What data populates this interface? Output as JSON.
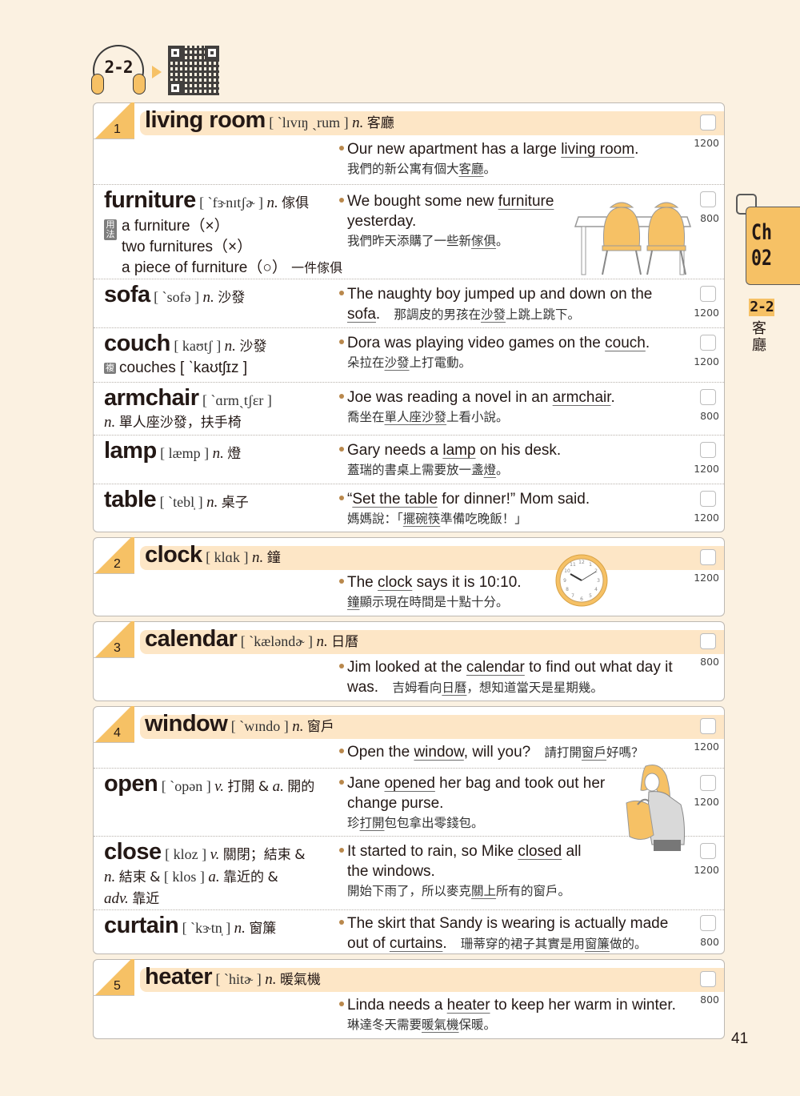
{
  "header": {
    "audio_track": "2-2",
    "audio_icon": "headphones-icon",
    "qr_icon": "qr-code-icon"
  },
  "side_tab": {
    "chapter_line1": "Ch",
    "chapter_line2": "02",
    "section": "2-2",
    "section_title_1": "客",
    "section_title_2": "廳"
  },
  "page_number": "41",
  "cards": [
    {
      "number": "1",
      "entries": [
        {
          "word": "living room",
          "ipa": "[ ˋlɪvɪŋ ˏrum ]",
          "pos": "n.",
          "zh": "客廳",
          "example_pre": "Our new apartment has a large ",
          "example_ul": "living room",
          "example_post": ".",
          "zh_pre": "我們的新公寓有個大",
          "zh_ul": "客廳",
          "zh_post": "。",
          "level": "1200",
          "checked": false
        },
        {
          "word": "furniture",
          "ipa": "[ ˋfɝnɪtʃɚ ]",
          "pos": "n.",
          "zh": "傢俱",
          "usage_tag": "用法",
          "usage_lines": [
            "a furniture（×）",
            "two furnitures（×）",
            "a piece of furniture（○）"
          ],
          "usage_zh": "一件傢俱",
          "example_pre": "We bought some new ",
          "example_ul": "furniture",
          "example_post": " yesterday.",
          "zh_pre": "我們昨天添購了一些新",
          "zh_ul": "傢俱",
          "zh_post": "。",
          "level": "800",
          "checked": false
        },
        {
          "word": "sofa",
          "ipa": "[ ˋsofə ]",
          "pos": "n.",
          "zh": "沙發",
          "example_pre": "The naughty boy jumped up and down on the ",
          "example_ul": "sofa",
          "example_post": ".",
          "zh_pre": "那調皮的男孩在",
          "zh_ul": "沙發",
          "zh_post": "上跳上跳下。",
          "level": "1200",
          "checked": false
        },
        {
          "word": "couch",
          "ipa": "[ kaʊtʃ ]",
          "pos": "n.",
          "zh": "沙發",
          "plural_tag": "複",
          "plural": "couches [ ˋkaʊtʃɪz ]",
          "example_pre": "Dora was playing video games on the ",
          "example_ul": "couch",
          "example_post": ".",
          "zh_pre": "朵拉在",
          "zh_ul": "沙發",
          "zh_post": "上打電動。",
          "level": "1200",
          "checked": false
        },
        {
          "word": "armchair",
          "ipa": "[ ˋɑrmˏtʃɛr ]",
          "pos": "n.",
          "zh": "單人座沙發，扶手椅",
          "example_pre": "Joe was reading a novel in an ",
          "example_ul": "armchair",
          "example_post": ".",
          "zh_pre": "喬坐在",
          "zh_ul": "單人座沙發",
          "zh_post": "上看小說。",
          "level": "800",
          "checked": false
        },
        {
          "word": "lamp",
          "ipa": "[ læmp ]",
          "pos": "n.",
          "zh": "燈",
          "example_pre": "Gary needs a ",
          "example_ul": "lamp",
          "example_post": " on his desk.",
          "zh_pre": "蓋瑞的書桌上需要放一盞",
          "zh_ul": "燈",
          "zh_post": "。",
          "level": "1200",
          "checked": false
        },
        {
          "word": "table",
          "ipa": "[ ˋtebl̩ ]",
          "pos": "n.",
          "zh": "桌子",
          "example_pre": "“",
          "example_ul": "Set the table",
          "example_post": " for dinner!” Mom said.",
          "zh_pre": "媽媽說：「",
          "zh_ul": "擺碗筷",
          "zh_post": "準備吃晚飯！」",
          "level": "1200",
          "checked": false
        }
      ]
    },
    {
      "number": "2",
      "entries": [
        {
          "word": "clock",
          "ipa": "[ klɑk ]",
          "pos": "n.",
          "zh": "鐘",
          "example_pre": "The ",
          "example_ul": "clock",
          "example_post": " says it is 10:10.",
          "zh_pre": "",
          "zh_ul": "鐘",
          "zh_post": "顯示現在時間是十點十分。",
          "level": "1200",
          "checked": false
        }
      ]
    },
    {
      "number": "3",
      "entries": [
        {
          "word": "calendar",
          "ipa": "[ ˋkæləndɚ ]",
          "pos": "n.",
          "zh": "日曆",
          "example_pre": "Jim looked at the ",
          "example_ul": "calendar",
          "example_post": " to find out what day it was.",
          "zh_pre": "吉姆看向",
          "zh_ul": "日曆",
          "zh_post": "，想知道當天是星期幾。",
          "level": "800",
          "checked": false
        }
      ]
    },
    {
      "number": "4",
      "entries": [
        {
          "word": "window",
          "ipa": "[ ˋwɪndo ]",
          "pos": "n.",
          "zh": "窗戶",
          "example_pre": "Open the ",
          "example_ul": "window",
          "example_post": ", will you?",
          "zh_pre": "請打開",
          "zh_ul": "窗戶",
          "zh_post": "好嗎？",
          "level": "1200",
          "checked": false
        },
        {
          "word": "open",
          "ipa": "[ ˋopən ]",
          "pos": "v.",
          "zh": "打開",
          "pos2": "a.",
          "zh2": "開的",
          "example_pre": "Jane ",
          "example_ul": "opened",
          "example_post": " her bag and took out her change purse.",
          "zh_pre": "珍",
          "zh_ul": "打開",
          "zh_post": "包包拿出零錢包。",
          "level": "1200",
          "checked": false
        },
        {
          "word": "close",
          "ipa": "[ kloz ]",
          "pos": "v.",
          "zh": "關閉；結束",
          "pos2": "n.",
          "zh2": "結束",
          "ipa2": "[ klos ]",
          "pos3": "a.",
          "zh3": "靠近的",
          "pos4": "adv.",
          "zh4": "靠近",
          "example_pre": "It started to rain, so Mike ",
          "example_ul": "closed",
          "example_post": " all the windows.",
          "zh_pre": "開始下雨了，所以麥克",
          "zh_ul": "關上",
          "zh_post": "所有的窗戶。",
          "level": "1200",
          "checked": false
        },
        {
          "word": "curtain",
          "ipa": "[ ˋkɝtn̩ ]",
          "pos": "n.",
          "zh": "窗簾",
          "example_pre": "The skirt that Sandy is wearing is actually made out of ",
          "example_ul": "curtains",
          "example_post": ".",
          "zh_pre": "珊蒂穿的裙子其實是用",
          "zh_ul": "窗簾",
          "zh_post": "做的。",
          "level": "800",
          "checked": false
        }
      ]
    },
    {
      "number": "5",
      "entries": [
        {
          "word": "heater",
          "ipa": "[ ˋhitɚ ]",
          "pos": "n.",
          "zh": "暖氣機",
          "example_pre": "Linda needs a ",
          "example_ul": "heater",
          "example_post": " to keep her warm in winter.",
          "zh_pre": "琳達冬天需要",
          "zh_ul": "暖氣機",
          "zh_post": "保暖。",
          "level": "800",
          "checked": false
        }
      ]
    }
  ],
  "colors": {
    "page_bg": "#fbf1e1",
    "accent_yellow": "#f6c165",
    "headword_band": "#fde6c6",
    "bullet": "#b9884c"
  },
  "illustrations": [
    "dining-table-chairs-illustration",
    "wall-clock-illustration",
    "woman-opening-bag-illustration"
  ]
}
